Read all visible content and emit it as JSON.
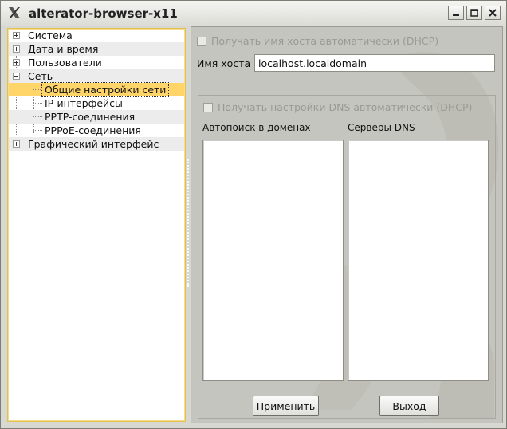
{
  "window": {
    "title": "alterator-browser-x11",
    "controls": {
      "minimize_icon": "minimize-icon",
      "maximize_icon": "maximize-icon",
      "close_icon": "close-icon"
    }
  },
  "tree": {
    "items": [
      {
        "label": "Система",
        "level": 0,
        "expander": "plus"
      },
      {
        "label": "Дата и время",
        "level": 0,
        "expander": "plus"
      },
      {
        "label": "Пользователи",
        "level": 0,
        "expander": "plus"
      },
      {
        "label": "Сеть",
        "level": 0,
        "expander": "minus"
      },
      {
        "label": "Общие настройки сети",
        "level": 1,
        "selected": true
      },
      {
        "label": "IP-интерфейсы",
        "level": 1
      },
      {
        "label": "PPTP-соединения",
        "level": 1
      },
      {
        "label": "PPPoE-соединения",
        "level": 1
      },
      {
        "label": "Графический интерфейс",
        "level": 0,
        "expander": "plus"
      }
    ]
  },
  "form": {
    "dhcp_hostname_label": "Получать имя хоста автоматически (DHCP)",
    "dhcp_hostname_checked": false,
    "hostname_label": "Имя хоста",
    "hostname_value": "localhost.localdomain",
    "dhcp_dns_label": "Получать настройки DNS автоматически (DHCP)",
    "dhcp_dns_checked": false,
    "search_domains_label": "Автопоиск в доменах",
    "dns_servers_label": "Серверы DNS",
    "apply_button": "Применить",
    "exit_button": "Выход"
  },
  "colors": {
    "selection": "#ffd56a",
    "tree_border": "#e5c04d",
    "panel_bg": "#c5c5bf"
  }
}
